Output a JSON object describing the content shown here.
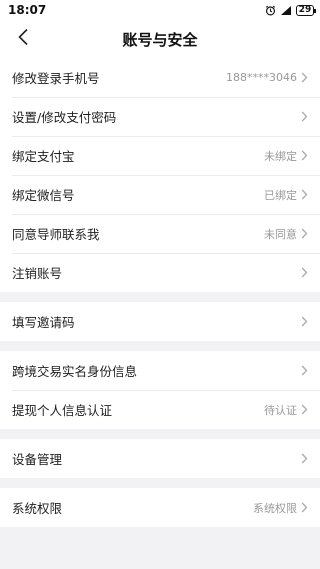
{
  "status": {
    "time": "18:07",
    "battery": "29"
  },
  "header": {
    "title": "账号与安全"
  },
  "groups": [
    {
      "items": [
        {
          "label": "修改登录手机号",
          "value": "188****3046"
        },
        {
          "label": "设置/修改支付密码",
          "value": ""
        },
        {
          "label": "绑定支付宝",
          "value": "未绑定"
        },
        {
          "label": "绑定微信号",
          "value": "已绑定"
        },
        {
          "label": "同意导师联系我",
          "value": "未同意"
        },
        {
          "label": "注销账号",
          "value": ""
        }
      ]
    },
    {
      "items": [
        {
          "label": "填写邀请码",
          "value": ""
        }
      ]
    },
    {
      "items": [
        {
          "label": "跨境交易实名身份信息",
          "value": ""
        },
        {
          "label": "提现个人信息认证",
          "value": "待认证"
        }
      ]
    },
    {
      "items": [
        {
          "label": "设备管理",
          "value": ""
        }
      ]
    },
    {
      "items": [
        {
          "label": "系统权限",
          "value": "系统权限"
        }
      ]
    }
  ]
}
